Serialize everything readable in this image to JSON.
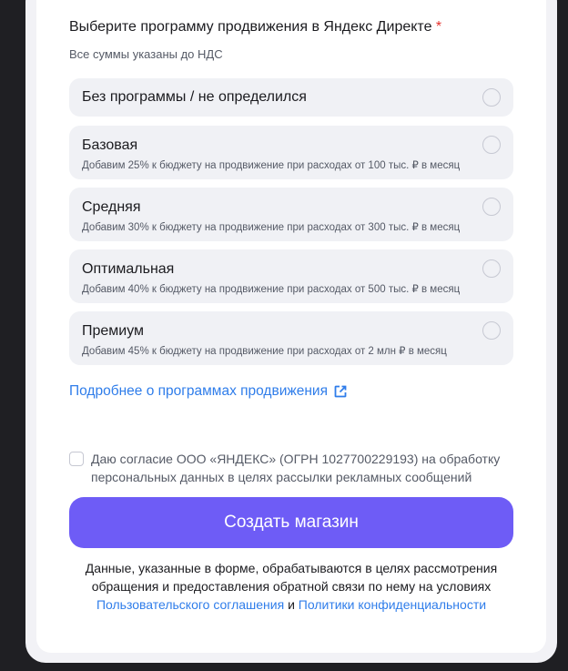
{
  "form": {
    "section_title": "Выберите программу продвижения в Яндекс Директе",
    "required_mark": "*",
    "section_subtitle": "Все суммы указаны до НДС",
    "options": [
      {
        "title": "Без программы / не определился",
        "desc": ""
      },
      {
        "title": "Базовая",
        "desc": "Добавим 25% к бюджету на продвижение при расходах от 100 тыс. ₽ в месяц"
      },
      {
        "title": "Средняя",
        "desc": "Добавим 30% к бюджету на продвижение при расходах от 300 тыс. ₽ в месяц"
      },
      {
        "title": "Оптимальная",
        "desc": "Добавим 40% к бюджету на продвижение при расходах от 500 тыс. ₽ в месяц"
      },
      {
        "title": "Премиум",
        "desc": "Добавим 45% к бюджету на продвижение при расходах от 2 млн ₽ в месяц"
      }
    ],
    "details_link": "Подробнее о программах продвижения",
    "external_icon": "external-link-icon",
    "consent_text": "Даю согласие ООО «ЯНДЕКС» (ОГРН 1027700229193) на обработку персональных данных в целях рассылки рекламных сообщений",
    "submit_label": "Создать магазин",
    "footer": {
      "text_before": "Данные, указанные в форме, обрабатываются в целях рассмотрения обращения и предоставления обратной связи по нему на условиях ",
      "link_terms": "Пользовательского соглашения",
      "conjunction": " и ",
      "link_privacy": "Политики конфиденциальности"
    }
  },
  "colors": {
    "accent_button": "#6e5cf6",
    "link": "#2f7dea",
    "required": "#e5322d",
    "option_bg": "#f0f1f5",
    "page_bg": "#1f1f23"
  }
}
